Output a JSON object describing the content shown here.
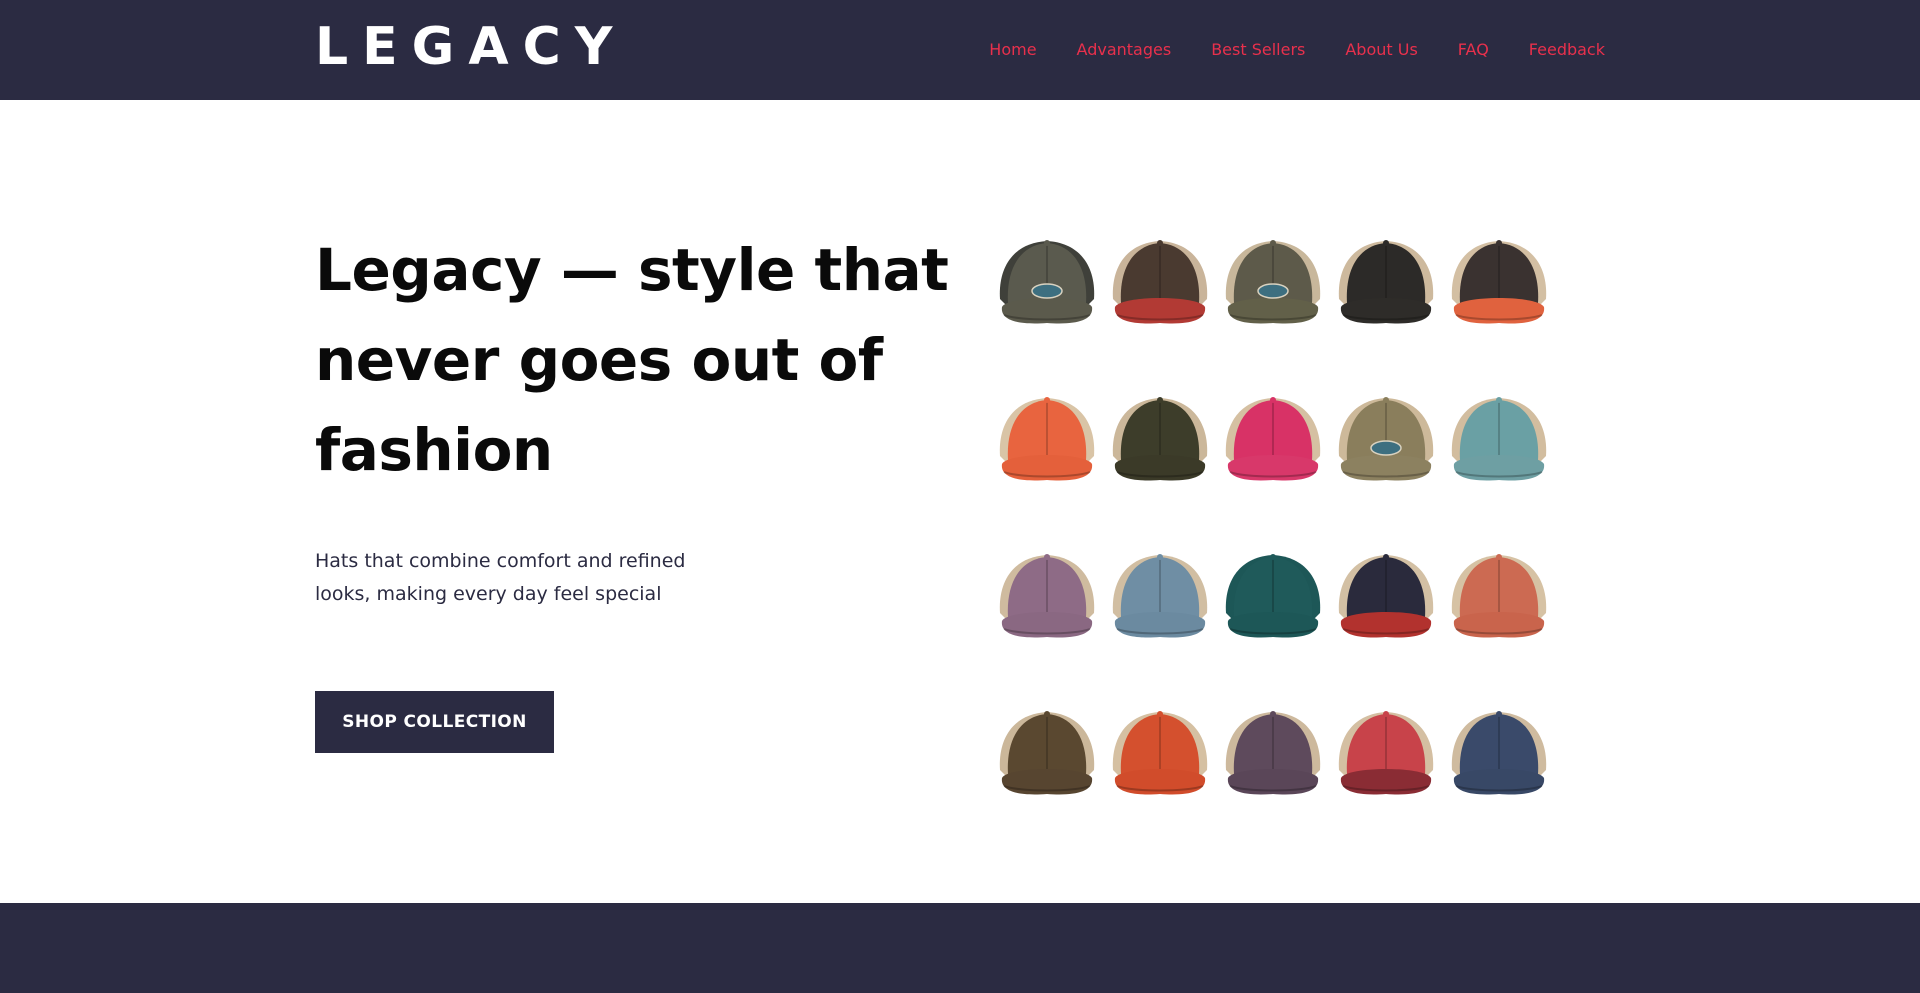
{
  "brand": {
    "logo_text": "LEGACY"
  },
  "nav": {
    "items": [
      {
        "label": "Home"
      },
      {
        "label": "Advantages"
      },
      {
        "label": "Best Sellers"
      },
      {
        "label": "About Us"
      },
      {
        "label": "FAQ"
      },
      {
        "label": "Feedback"
      }
    ]
  },
  "hero": {
    "title": "Legacy — style that never goes out of fashion",
    "subtitle": "Hats that combine comfort and refined looks, making every day feel special",
    "cta_label": "SHOP COLLECTION"
  },
  "colors": {
    "dark_navy": "#2b2b42",
    "nav_link": "#e8304c",
    "white": "#ffffff"
  },
  "hats": [
    {
      "name": "olive-patch-cap",
      "crown": "#5a5a4e",
      "brim": "#5b5a4c",
      "mesh": "#3f403a",
      "patch": true
    },
    {
      "name": "brown-red-cap",
      "crown": "#4a3a30",
      "brim": "#b23a34",
      "mesh": "#c9b49a",
      "patch": false
    },
    {
      "name": "moss-patch-cap",
      "crown": "#5d5a4a",
      "brim": "#626049",
      "mesh": "#c8b79b",
      "patch": true
    },
    {
      "name": "black-khaki-cap",
      "crown": "#2c2a28",
      "brim": "#2e2c29",
      "mesh": "#cdb99d",
      "patch": false
    },
    {
      "name": "charcoal-orange-cap",
      "crown": "#3a3230",
      "brim": "#e0623e",
      "mesh": "#d3bfa3",
      "patch": false
    },
    {
      "name": "orange-cap",
      "crown": "#e8643f",
      "brim": "#e4603b",
      "mesh": "#d9c4a6",
      "patch": false
    },
    {
      "name": "army-green-cap",
      "crown": "#3d3d2a",
      "brim": "#3b3a28",
      "mesh": "#cbb79a",
      "patch": false
    },
    {
      "name": "pink-cap",
      "crown": "#d83266",
      "brim": "#d8386a",
      "mesh": "#d5c0a2",
      "patch": false
    },
    {
      "name": "camo-khaki-cap",
      "crown": "#8a7e5c",
      "brim": "#8c8160",
      "mesh": "#cdb99a",
      "patch": true
    },
    {
      "name": "teal-floral-cap",
      "crown": "#6aa0a4",
      "brim": "#6e9fa3",
      "mesh": "#d2bd9f",
      "patch": false
    },
    {
      "name": "mauve-cap",
      "crown": "#8e6b86",
      "brim": "#8a6882",
      "mesh": "#cfbb9f",
      "patch": false
    },
    {
      "name": "slate-blue-cap",
      "crown": "#6f8ea4",
      "brim": "#6b8aa0",
      "mesh": "#d1bea2",
      "patch": false
    },
    {
      "name": "teal-cap",
      "crown": "#1f5a5a",
      "brim": "#1d5757",
      "mesh": "#1d5757",
      "patch": false
    },
    {
      "name": "stars-cap",
      "crown": "#2a2a3c",
      "brim": "#b2322e",
      "mesh": "#d3c0a4",
      "patch": false
    },
    {
      "name": "rust-cap",
      "crown": "#cc6a52",
      "brim": "#c9644c",
      "mesh": "#d6c2a4",
      "patch": false
    },
    {
      "name": "brown-cap",
      "crown": "#5a4830",
      "brim": "#574530",
      "mesh": "#cbb79a",
      "patch": false
    },
    {
      "name": "burnt-orange-cap",
      "crown": "#d4502e",
      "brim": "#d14c2b",
      "mesh": "#d5c0a2",
      "patch": false
    },
    {
      "name": "plum-cap",
      "crown": "#5e4a5c",
      "brim": "#5a4658",
      "mesh": "#cdb99d",
      "patch": false
    },
    {
      "name": "red-stripe-cap",
      "crown": "#c8434a",
      "brim": "#8a2c34",
      "mesh": "#d4bfa2",
      "patch": false
    },
    {
      "name": "navy-cap",
      "crown": "#3a4a6a",
      "brim": "#384866",
      "mesh": "#cfbb9f",
      "patch": false
    }
  ]
}
